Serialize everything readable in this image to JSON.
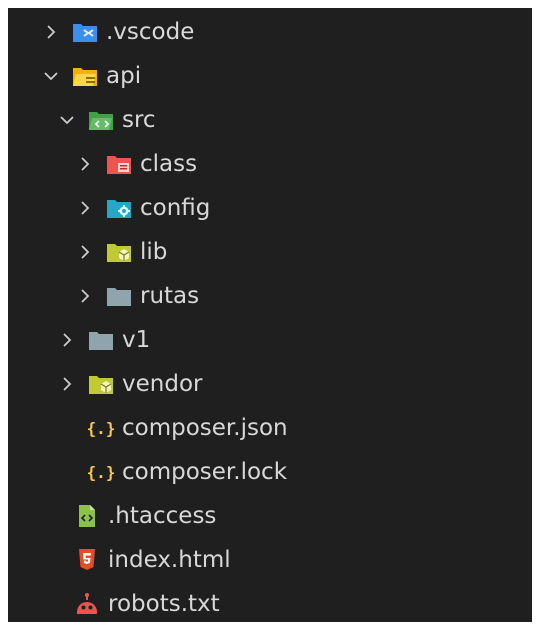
{
  "explorer": {
    "items": [
      {
        "label": ".vscode",
        "kind": "folder",
        "expanded": false,
        "icon": "folder-vscode-icon",
        "color": "#3b8eea"
      },
      {
        "label": "api",
        "kind": "folder",
        "expanded": true,
        "icon": "folder-api-icon",
        "color": "#f0b400"
      },
      {
        "label": "src",
        "kind": "folder",
        "expanded": true,
        "icon": "folder-src-icon",
        "color": "#4caf50"
      },
      {
        "label": "class",
        "kind": "folder",
        "expanded": false,
        "icon": "folder-class-icon",
        "color": "#ef5350"
      },
      {
        "label": "config",
        "kind": "folder",
        "expanded": false,
        "icon": "folder-config-icon",
        "color": "#26a6c9"
      },
      {
        "label": "lib",
        "kind": "folder",
        "expanded": false,
        "icon": "folder-lib-icon",
        "color": "#c0ca33"
      },
      {
        "label": "rutas",
        "kind": "folder",
        "expanded": false,
        "icon": "folder-icon",
        "color": "#90a4ae"
      },
      {
        "label": "v1",
        "kind": "folder",
        "expanded": false,
        "icon": "folder-icon",
        "color": "#90a4ae"
      },
      {
        "label": "vendor",
        "kind": "folder",
        "expanded": false,
        "icon": "folder-vendor-icon",
        "color": "#c0ca33"
      },
      {
        "label": "composer.json",
        "kind": "file",
        "icon": "json-braces-icon",
        "color": "#f9c74f"
      },
      {
        "label": "composer.lock",
        "kind": "file",
        "icon": "json-braces-icon",
        "color": "#f9c74f"
      },
      {
        "label": ".htaccess",
        "kind": "file",
        "icon": "htaccess-file-icon",
        "color": "#8bc34a"
      },
      {
        "label": "index.html",
        "kind": "file",
        "icon": "html5-icon",
        "color": "#e44d26"
      },
      {
        "label": "robots.txt",
        "kind": "file",
        "icon": "robot-icon",
        "color": "#ef5350"
      }
    ]
  }
}
